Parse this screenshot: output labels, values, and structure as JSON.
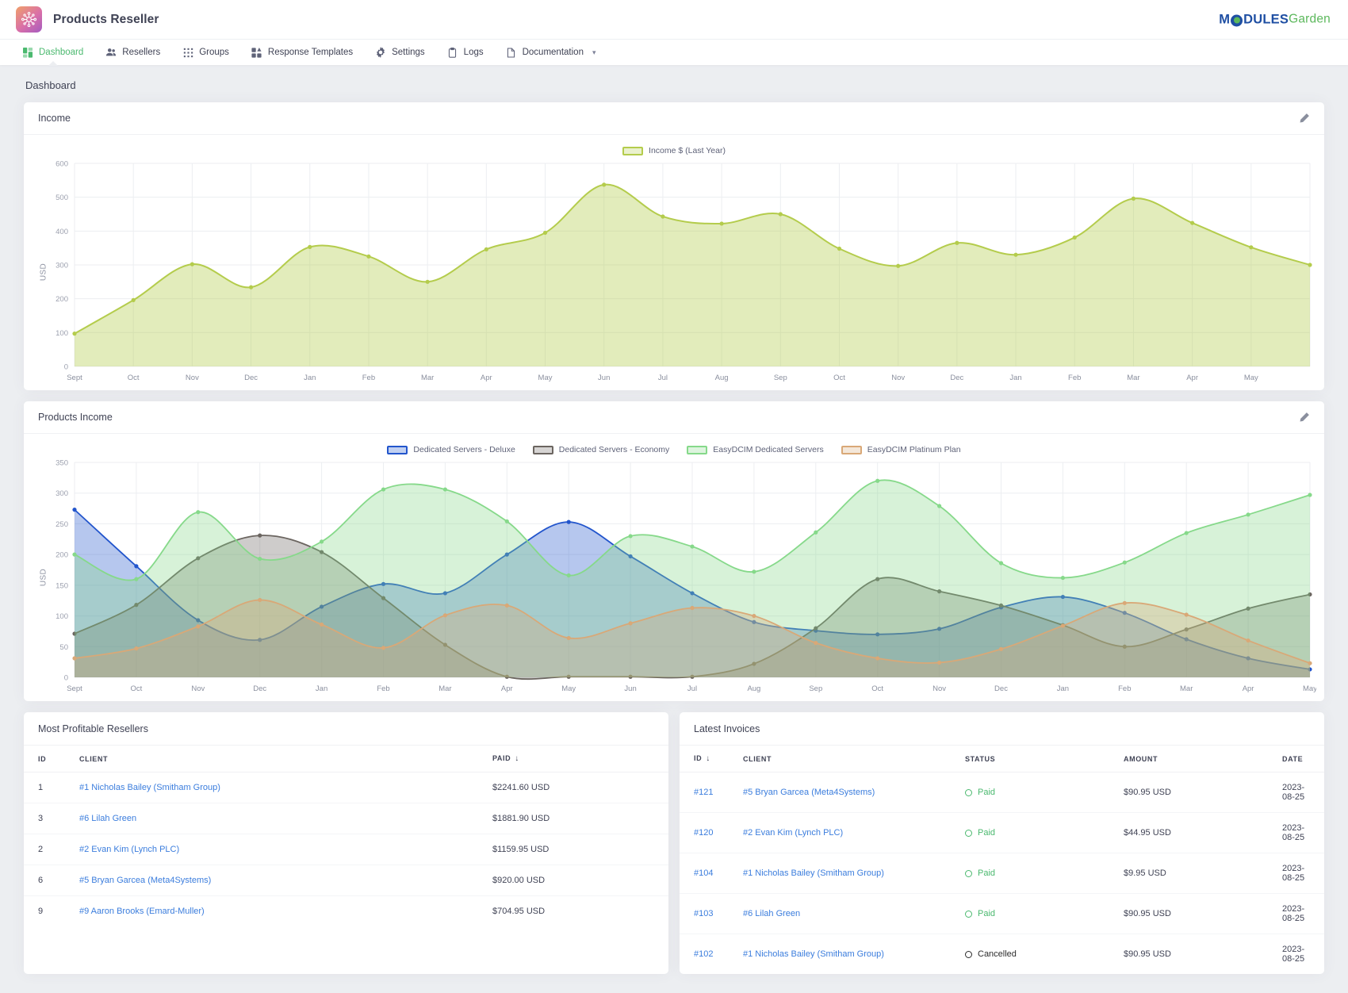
{
  "header": {
    "app_title": "Products Reseller",
    "logo_icon": "molecule-icon",
    "vendor": {
      "part1": "M",
      "o": "o",
      "part2": "DULES",
      "part3": "Garden"
    }
  },
  "nav": {
    "items": [
      {
        "label": "Dashboard",
        "icon": "grid-squares-icon",
        "active": true,
        "caret": false
      },
      {
        "label": "Resellers",
        "icon": "users-icon",
        "active": false,
        "caret": false
      },
      {
        "label": "Groups",
        "icon": "dots-grid-icon",
        "active": false,
        "caret": false
      },
      {
        "label": "Response Templates",
        "icon": "layout-blocks-icon",
        "active": false,
        "caret": false
      },
      {
        "label": "Settings",
        "icon": "gear-icon",
        "active": false,
        "caret": false
      },
      {
        "label": "Logs",
        "icon": "clipboard-icon",
        "active": false,
        "caret": false
      },
      {
        "label": "Documentation",
        "icon": "document-icon",
        "active": false,
        "caret": true
      }
    ]
  },
  "page": {
    "title": "Dashboard"
  },
  "income_card": {
    "title": "Income",
    "edit_icon": "pencil-icon"
  },
  "products_card": {
    "title": "Products Income",
    "edit_icon": "pencil-icon"
  },
  "colors": {
    "income_line": "#b4cc4c",
    "income_fill": "#e3ebc0",
    "deluxe": "#2255cc",
    "economy": "#6b6560",
    "easydcim_dedicated": "#86d98a",
    "easydcim_platinum": "#d9a877",
    "link": "#3b7ddd",
    "paid": "#4bb96f",
    "accent": "#4bb96f"
  },
  "chart_data": [
    {
      "type": "area",
      "title": "Income",
      "xlabel": "",
      "ylabel": "USD",
      "ylim": [
        0,
        600
      ],
      "yticks": [
        0,
        100,
        200,
        300,
        400,
        500,
        600
      ],
      "grid": true,
      "legend_position": "top-center",
      "legend": [
        "Income $ (Last Year)"
      ],
      "categories": [
        "Sept",
        "Oct",
        "Nov",
        "Dec",
        "Jan",
        "Feb",
        "Mar",
        "Apr",
        "May",
        "Jun",
        "Jul",
        "Aug",
        "Sep",
        "Oct",
        "Nov",
        "Dec",
        "Jan",
        "Feb",
        "Mar",
        "Apr",
        "May"
      ],
      "series": [
        {
          "name": "Income $ (Last Year)",
          "color": "#b4cc4c",
          "values": [
            97,
            196,
            302,
            234,
            353,
            325,
            250,
            346,
            395,
            537,
            443,
            422,
            450,
            348,
            297,
            365,
            330,
            381,
            496,
            424,
            352,
            300
          ]
        }
      ]
    },
    {
      "type": "area",
      "title": "Products Income",
      "xlabel": "",
      "ylabel": "USD",
      "ylim": [
        0,
        350
      ],
      "yticks": [
        0,
        50,
        100,
        150,
        200,
        250,
        300,
        350
      ],
      "grid": true,
      "legend_position": "top-center",
      "categories": [
        "Sept",
        "Oct",
        "Nov",
        "Dec",
        "Jan",
        "Feb",
        "Mar",
        "Apr",
        "May",
        "Jun",
        "Jul",
        "Aug",
        "Sep",
        "Oct",
        "Nov",
        "Dec",
        "Jan",
        "Feb",
        "Mar",
        "Apr",
        "May"
      ],
      "series": [
        {
          "name": "Dedicated Servers - Deluxe",
          "color": "#2255cc",
          "values": [
            273,
            181,
            93,
            61,
            115,
            152,
            137,
            200,
            253,
            197,
            137,
            90,
            76,
            70,
            79,
            114,
            131,
            105,
            62,
            31,
            13
          ]
        },
        {
          "name": "Dedicated Servers - Economy",
          "color": "#6b6560",
          "values": [
            71,
            118,
            194,
            231,
            204,
            129,
            53,
            1,
            1,
            1,
            1,
            22,
            80,
            160,
            140,
            117,
            85,
            50,
            78,
            112,
            135
          ]
        },
        {
          "name": "EasyDCIM Dedicated Servers",
          "color": "#86d98a",
          "values": [
            200,
            160,
            269,
            193,
            221,
            306,
            306,
            254,
            166,
            230,
            213,
            172,
            236,
            320,
            279,
            186,
            162,
            187,
            235,
            265,
            297
          ]
        },
        {
          "name": "EasyDCIM Platinum Plan",
          "color": "#d9a877",
          "values": [
            31,
            47,
            83,
            126,
            86,
            48,
            101,
            117,
            64,
            88,
            113,
            100,
            56,
            31,
            24,
            46,
            84,
            121,
            102,
            60,
            23
          ]
        }
      ]
    }
  ],
  "resellers_table": {
    "title": "Most Profitable Resellers",
    "columns": [
      "ID",
      "CLIENT",
      "PAID"
    ],
    "sort_column": "PAID",
    "sort_arrow": "↓",
    "rows": [
      {
        "id": "1",
        "client": "#1 Nicholas Bailey (Smitham Group)",
        "paid": "$2241.60 USD"
      },
      {
        "id": "3",
        "client": "#6 Lilah Green",
        "paid": "$1881.90 USD"
      },
      {
        "id": "2",
        "client": "#2 Evan Kim (Lynch PLC)",
        "paid": "$1159.95 USD"
      },
      {
        "id": "6",
        "client": "#5 Bryan Garcea (Meta4Systems)",
        "paid": "$920.00 USD"
      },
      {
        "id": "9",
        "client": "#9 Aaron Brooks (Emard-Muller)",
        "paid": "$704.95 USD"
      }
    ]
  },
  "invoices_table": {
    "title": "Latest Invoices",
    "columns": [
      "ID",
      "CLIENT",
      "STATUS",
      "AMOUNT",
      "DATE"
    ],
    "sort_column": "ID",
    "sort_arrow": "↓",
    "rows": [
      {
        "id": "#121",
        "client": "#5 Bryan Garcea (Meta4Systems)",
        "status": "Paid",
        "status_kind": "paid",
        "amount": "$90.95 USD",
        "date": "2023-08-25"
      },
      {
        "id": "#120",
        "client": "#2 Evan Kim (Lynch PLC)",
        "status": "Paid",
        "status_kind": "paid",
        "amount": "$44.95 USD",
        "date": "2023-08-25"
      },
      {
        "id": "#104",
        "client": "#1 Nicholas Bailey (Smitham Group)",
        "status": "Paid",
        "status_kind": "paid",
        "amount": "$9.95 USD",
        "date": "2023-08-25"
      },
      {
        "id": "#103",
        "client": "#6 Lilah Green",
        "status": "Paid",
        "status_kind": "paid",
        "amount": "$90.95 USD",
        "date": "2023-08-25"
      },
      {
        "id": "#102",
        "client": "#1 Nicholas Bailey (Smitham Group)",
        "status": "Cancelled",
        "status_kind": "cancelled",
        "amount": "$90.95 USD",
        "date": "2023-08-25"
      }
    ]
  }
}
